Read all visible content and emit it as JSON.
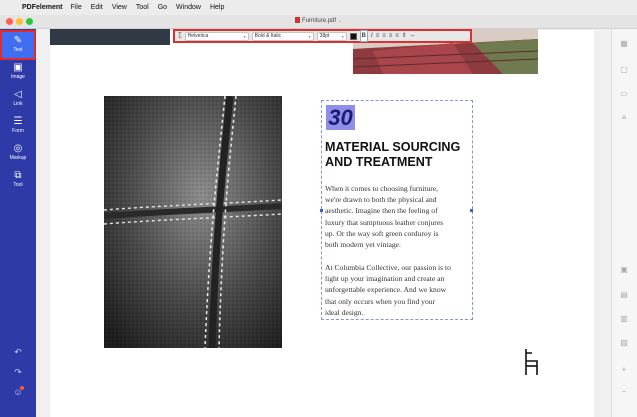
{
  "menubar": {
    "app_name": "PDFelement",
    "items": [
      "File",
      "Edit",
      "View",
      "Tool",
      "Go",
      "Window",
      "Help"
    ]
  },
  "window": {
    "doc_title": "Furniture.pdf",
    "traffic_colors": [
      "#ff5f57",
      "#febc2e",
      "#28c840"
    ]
  },
  "sidebar": {
    "tools": [
      {
        "label": "Text",
        "icon": "pencil-icon",
        "glyph": "✎",
        "active": true
      },
      {
        "label": "Image",
        "icon": "image-icon",
        "glyph": "▣",
        "active": false
      },
      {
        "label": "Link",
        "icon": "link-icon",
        "glyph": "◁",
        "active": false
      },
      {
        "label": "Form",
        "icon": "form-icon",
        "glyph": "☰",
        "active": false
      },
      {
        "label": "Markup",
        "icon": "markup-icon",
        "glyph": "◎",
        "active": false
      },
      {
        "label": "Tool",
        "icon": "tool-icon",
        "glyph": "⧉",
        "active": false
      }
    ],
    "undo_glyph": "↶",
    "redo_glyph": "↷",
    "account_glyph": "☺",
    "accent": "#2d3aa8"
  },
  "format_toolbar": {
    "font": "Helvetica",
    "style": "Bold & Italic",
    "size": "38pt",
    "bold": "B",
    "italic": "I"
  },
  "content": {
    "number": "30",
    "heading": "MATERIAL SOURCING\nAND TREATMENT",
    "paragraph1": "When it comes to choosing furniture,\nwe're drawn to both the physical and\naesthetic. Imagine then the feeling of\nluxury that sumptuous leather conjures\nup. Or the way soft green corduroy is\nboth modern yet vintage.",
    "paragraph2": "At Columbia Collective, our passion is to\nlight up your imagination and create an\nunforgettable experience. And we know\nthat only occurs when you find your\nideal design."
  }
}
